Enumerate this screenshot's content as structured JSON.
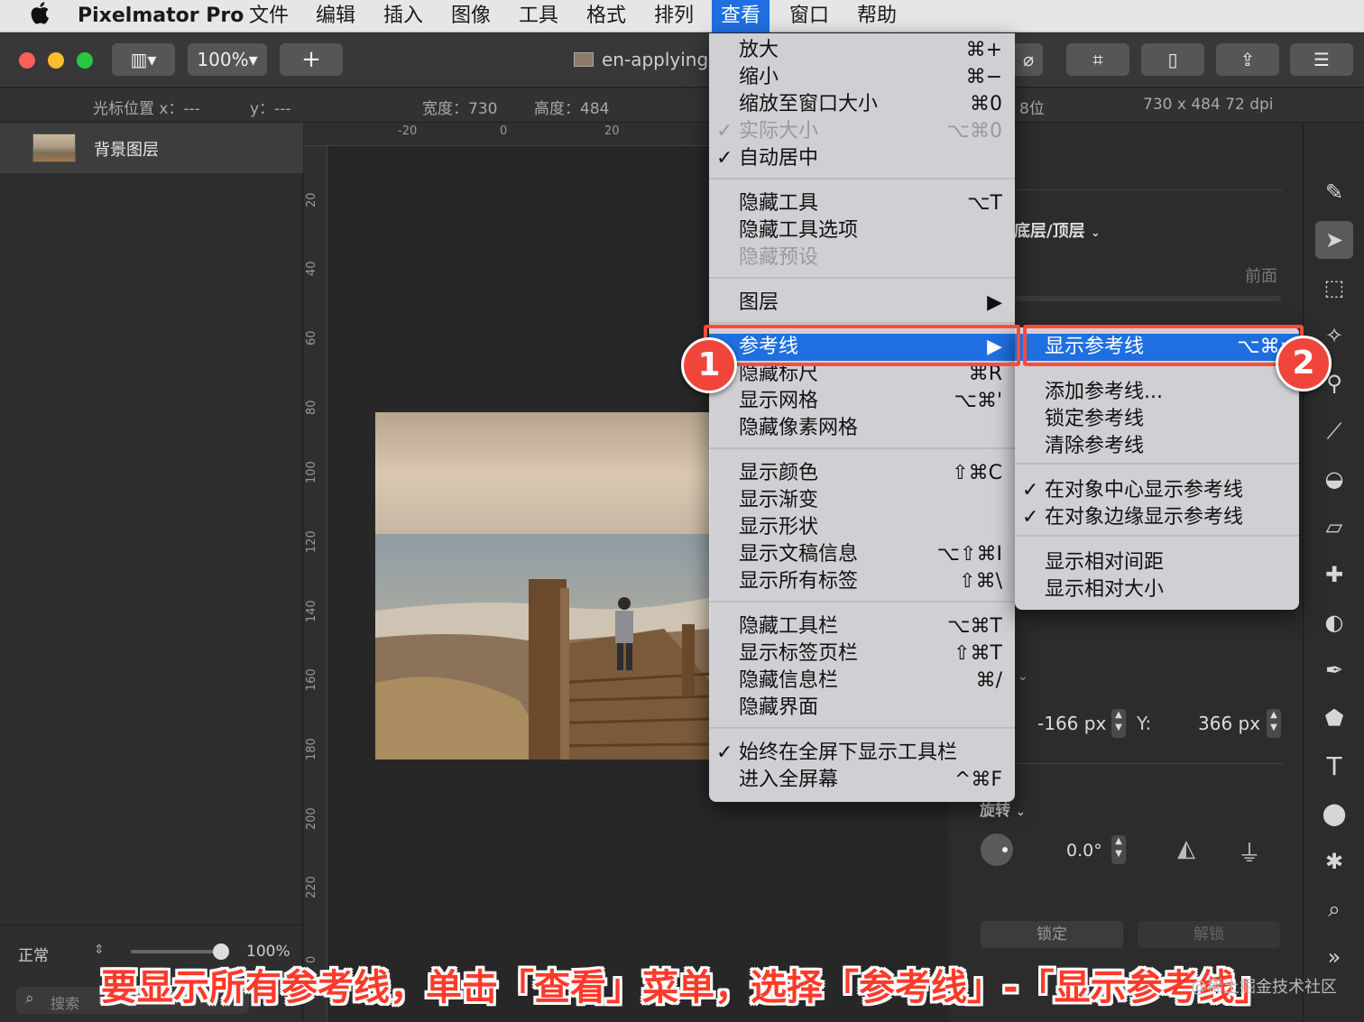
{
  "menubar": {
    "apple": "",
    "app": "Pixelmator Pro",
    "items": [
      "文件",
      "编辑",
      "插入",
      "图像",
      "工具",
      "格式",
      "排列",
      "查看",
      "窗口",
      "帮助"
    ]
  },
  "toolbar": {
    "zoom": "100%▾",
    "add": "+",
    "doc_title": "en-applying"
  },
  "infobar": {
    "cursor_x": "光标位置 x：---",
    "cursor_y": "y：---",
    "width": "宽度：730",
    "height": "高度：484",
    "bits": "8位",
    "size": "730 x 484 72 dpi"
  },
  "layers": {
    "background": "背景图层",
    "blend_mode": "正常",
    "opacity": "100%",
    "search_placeholder": "搜索"
  },
  "ruler": {
    "h": [
      "-20",
      "0",
      "20"
    ],
    "v": [
      "20",
      "40",
      "60",
      "80",
      "100",
      "120",
      "140",
      "160",
      "180",
      "200",
      "220",
      "0"
    ]
  },
  "view_menu": [
    {
      "label": "放大",
      "shortcut": "⌘+"
    },
    {
      "label": "缩小",
      "shortcut": "⌘−"
    },
    {
      "label": "缩放至窗口大小",
      "shortcut": "⌘0"
    },
    {
      "label": "实际大小",
      "shortcut": "⌥⌘0",
      "checked": true,
      "disabled": true
    },
    {
      "label": "自动居中",
      "shortcut": "",
      "checked": true
    },
    {
      "label": "隐藏工具",
      "shortcut": "⌥T"
    },
    {
      "label": "隐藏工具选项",
      "shortcut": ""
    },
    {
      "label": "隐藏预设",
      "shortcut": "",
      "disabled": true
    },
    {
      "label": "图层",
      "shortcut": "▶"
    },
    {
      "label": "参考线",
      "shortcut": "▶",
      "highlighted": true
    },
    {
      "label": "隐藏标尺",
      "shortcut": "⌘R"
    },
    {
      "label": "显示网格",
      "shortcut": "⌥⌘'"
    },
    {
      "label": "隐藏像素网格",
      "shortcut": ""
    },
    {
      "label": "显示颜色",
      "shortcut": "⇧⌘C"
    },
    {
      "label": "显示渐变",
      "shortcut": ""
    },
    {
      "label": "显示形状",
      "shortcut": ""
    },
    {
      "label": "显示文稿信息",
      "shortcut": "⌥⇧⌘I"
    },
    {
      "label": "显示所有标签",
      "shortcut": "⇧⌘\\"
    },
    {
      "label": "隐藏工具栏",
      "shortcut": "⌥⌘T"
    },
    {
      "label": "显示标签页栏",
      "shortcut": "⇧⌘T"
    },
    {
      "label": "隐藏信息栏",
      "shortcut": "⌘/"
    },
    {
      "label": "隐藏界面",
      "shortcut": ""
    },
    {
      "label": "始终在全屏下显示工具栏",
      "shortcut": "",
      "checked": true
    },
    {
      "label": "进入全屏幕",
      "shortcut": "^⌘F"
    }
  ],
  "guides_submenu": [
    {
      "label": "显示参考线",
      "shortcut": "⌥⌘;",
      "highlighted": true
    },
    {
      "label": "添加参考线...",
      "shortcut": ""
    },
    {
      "label": "锁定参考线",
      "shortcut": ""
    },
    {
      "label": "清除参考线",
      "shortcut": ""
    },
    {
      "label": "在对象中心显示参考线",
      "shortcut": "",
      "checked": true
    },
    {
      "label": "在对象边缘显示参考线",
      "shortcut": "",
      "checked": true
    },
    {
      "label": "显示相对间距",
      "shortcut": ""
    },
    {
      "label": "显示相对大小",
      "shortcut": ""
    }
  ],
  "right_panel": {
    "arrange": "底层/顶层",
    "front": "前面",
    "x_value": "-166 px",
    "y_label": "Y:",
    "y_value": "366 px",
    "rotate": "旋转",
    "rotate_value": "0.0°",
    "lock": "锁定",
    "unlock": "解锁"
  },
  "badges": [
    "1",
    "2"
  ],
  "caption": "要显示所有参考线，单击「查看」菜单，选择「参考线」-「显示参考线」",
  "watermark": "@稀土掘金技术社区",
  "colors": {
    "accent": "#1f6fe0",
    "annotation": "#ff4a3d"
  }
}
